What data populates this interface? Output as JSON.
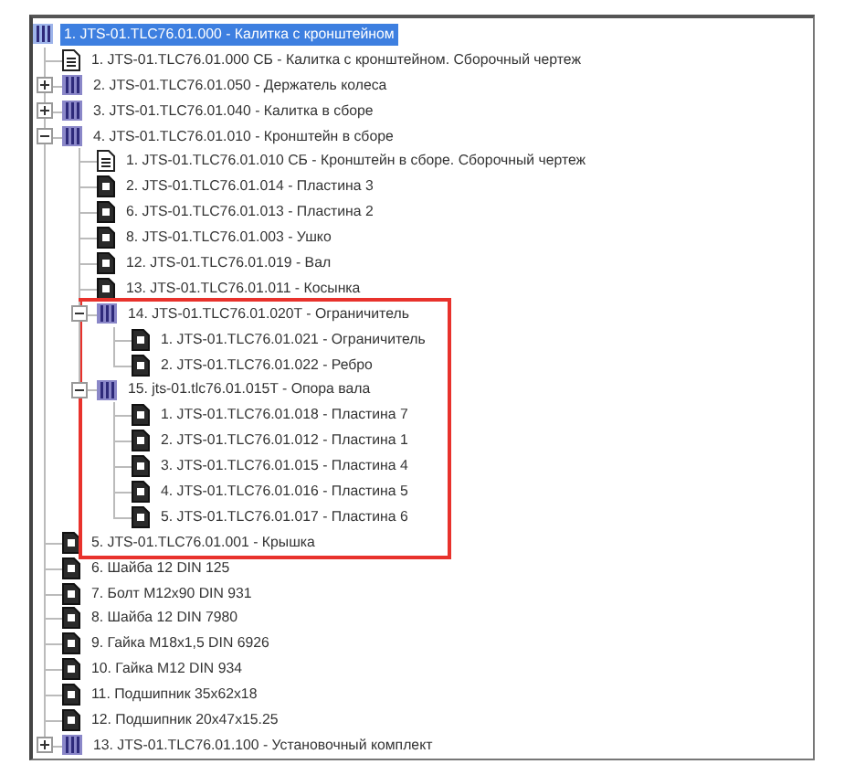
{
  "tree": {
    "label": "1. JTS-01.TLC76.01.000 - Калитка с кронштейном",
    "kind": "assembly",
    "selected": true,
    "framed": false,
    "children": [
      {
        "label": "1. JTS-01.TLC76.01.000 СБ - Калитка с кронштейном. Сборочный чертеж",
        "kind": "document",
        "selected": false,
        "framed": false
      },
      {
        "label": "2. JTS-01.TLC76.01.050 - Держатель колеса",
        "kind": "assembly",
        "expanded": false,
        "selected": false,
        "framed": false
      },
      {
        "label": "3. JTS-01.TLC76.01.040 - Калитка в сборе",
        "kind": "assembly",
        "expanded": false,
        "selected": false,
        "framed": false
      },
      {
        "label": "4. JTS-01.TLC76.01.010 - Кронштейн в сборе",
        "kind": "assembly",
        "expanded": true,
        "selected": false,
        "framed": false,
        "children": [
          {
            "label": "1. JTS-01.TLC76.01.010 СБ - Кронштейн в сборе. Сборочный чертеж",
            "kind": "document",
            "selected": false,
            "framed": false
          },
          {
            "label": "2. JTS-01.TLC76.01.014 - Пластина 3",
            "kind": "part",
            "selected": false,
            "framed": false
          },
          {
            "label": "6. JTS-01.TLC76.01.013 - Пластина 2",
            "kind": "part",
            "selected": false,
            "framed": false
          },
          {
            "label": "8. JTS-01.TLC76.01.003 - Ушко",
            "kind": "part",
            "selected": false,
            "framed": false
          },
          {
            "label": "12. JTS-01.TLC76.01.019 - Вал",
            "kind": "part",
            "selected": false,
            "framed": false
          },
          {
            "label": "13. JTS-01.TLC76.01.011 - Косынка",
            "kind": "part",
            "selected": false,
            "framed": false
          },
          {
            "label": "14. JTS-01.TLC76.01.020T - Ограничитель",
            "kind": "assembly",
            "expanded": true,
            "selected": false,
            "framed": true,
            "children": [
              {
                "label": "1. JTS-01.TLC76.01.021 - Ограничитель",
                "kind": "part",
                "selected": false,
                "framed": true
              },
              {
                "label": "2. JTS-01.TLC76.01.022 - Ребро",
                "kind": "part",
                "selected": false,
                "framed": true
              }
            ]
          },
          {
            "label": "15. jts-01.tlc76.01.015T - Опора вала",
            "kind": "assembly",
            "expanded": true,
            "selected": false,
            "framed": true,
            "children": [
              {
                "label": "1. JTS-01.TLC76.01.018 - Пластина 7",
                "kind": "part",
                "selected": false,
                "framed": true
              },
              {
                "label": "2. JTS-01.TLC76.01.012 - Пластина 1",
                "kind": "part",
                "selected": false,
                "framed": true
              },
              {
                "label": "3. JTS-01.TLC76.01.015 - Пластина 4",
                "kind": "part",
                "selected": false,
                "framed": true
              },
              {
                "label": "4. JTS-01.TLC76.01.016 - Пластина 5",
                "kind": "part",
                "selected": false,
                "framed": true
              },
              {
                "label": "5. JTS-01.TLC76.01.017 - Пластина 6",
                "kind": "part",
                "selected": false,
                "framed": true
              }
            ]
          }
        ]
      },
      {
        "label": "5. JTS-01.TLC76.01.001 - Крышка",
        "kind": "part",
        "selected": false,
        "framed": true
      },
      {
        "label": "6. Шайба 12 DIN 125",
        "kind": "part",
        "selected": false,
        "framed": false
      },
      {
        "label": "7. Болт M12x90 DIN 931",
        "kind": "part",
        "selected": false,
        "framed": false
      },
      {
        "label": "8. Шайба 12 DIN 7980",
        "kind": "part",
        "selected": false,
        "framed": false
      },
      {
        "label": "9. Гайка M18x1,5 DIN 6926",
        "kind": "part",
        "selected": false,
        "framed": false
      },
      {
        "label": "10. Гайка M12 DIN 934",
        "kind": "part",
        "selected": false,
        "framed": false
      },
      {
        "label": "11. Подшипник 35x62x18",
        "kind": "part",
        "selected": false,
        "framed": false
      },
      {
        "label": "12. Подшипник 20x47x15.25",
        "kind": "part",
        "selected": false,
        "framed": false
      },
      {
        "label": "13. JTS-01.TLC76.01.100 - Установочный комплект",
        "kind": "assembly",
        "expanded": false,
        "selected": false,
        "framed": false
      }
    ]
  }
}
